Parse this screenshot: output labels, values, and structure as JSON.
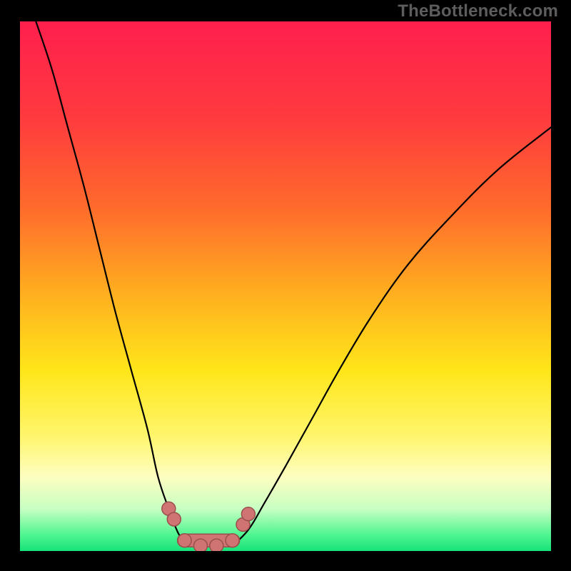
{
  "watermark": "TheBottleneck.com",
  "colors": {
    "background_frame": "#000000",
    "gradient_stops": [
      {
        "offset": 0.0,
        "color": "#ff1f4d"
      },
      {
        "offset": 0.18,
        "color": "#ff3a3f"
      },
      {
        "offset": 0.35,
        "color": "#ff6a2c"
      },
      {
        "offset": 0.52,
        "color": "#ffb11f"
      },
      {
        "offset": 0.66,
        "color": "#ffe61a"
      },
      {
        "offset": 0.78,
        "color": "#fff56a"
      },
      {
        "offset": 0.86,
        "color": "#fdfec0"
      },
      {
        "offset": 0.92,
        "color": "#c8ffc3"
      },
      {
        "offset": 0.97,
        "color": "#4ef590"
      },
      {
        "offset": 1.0,
        "color": "#18e27a"
      }
    ],
    "curve": "#000000",
    "marker_fill": "#cf7472",
    "marker_stroke": "#9a4f4d"
  },
  "chart_data": {
    "type": "line",
    "title": "",
    "xlabel": "",
    "ylabel": "",
    "xlim": [
      0,
      100
    ],
    "ylim": [
      0,
      100
    ],
    "grid": false,
    "note": "Axes are unlabeled; values are approximate readings of the plotted curves as percentages of the plot area, origin at bottom-left.",
    "series": [
      {
        "name": "left-branch",
        "x": [
          3,
          6,
          9,
          12,
          15,
          18,
          21,
          24,
          26,
          28,
          30,
          32
        ],
        "y": [
          100,
          91,
          80,
          69,
          57,
          45,
          34,
          23,
          14,
          8,
          3,
          1
        ]
      },
      {
        "name": "right-branch",
        "x": [
          40,
          43,
          46,
          50,
          55,
          60,
          66,
          73,
          81,
          90,
          100
        ],
        "y": [
          1,
          4,
          9,
          16,
          25,
          34,
          44,
          54,
          63,
          72,
          80
        ]
      }
    ],
    "markers": {
      "name": "highlighted-points",
      "points": [
        {
          "x": 28,
          "y": 8
        },
        {
          "x": 29,
          "y": 6
        },
        {
          "x": 31,
          "y": 2
        },
        {
          "x": 34,
          "y": 1
        },
        {
          "x": 37,
          "y": 1
        },
        {
          "x": 40,
          "y": 2
        },
        {
          "x": 42,
          "y": 5
        },
        {
          "x": 43,
          "y": 7
        }
      ]
    }
  }
}
